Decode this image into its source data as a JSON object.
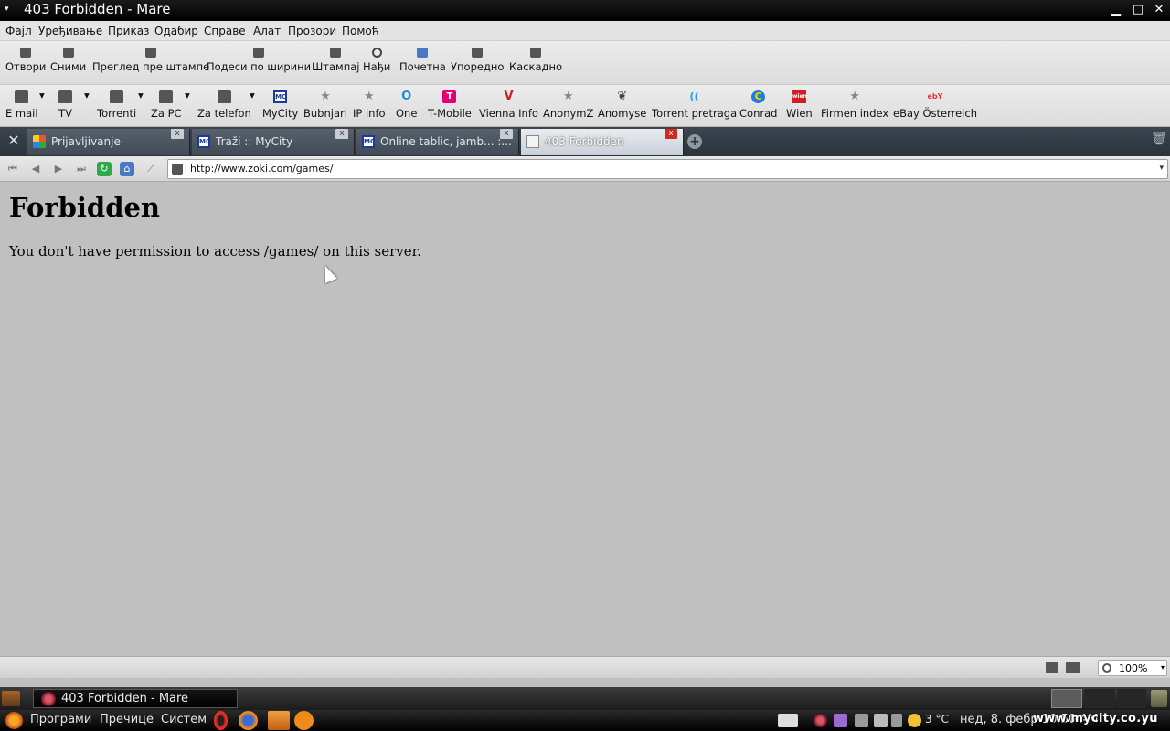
{
  "window": {
    "title": "403 Forbidden - Mare",
    "menu_arrow": "▾",
    "minimize": "▁",
    "maximize": "□",
    "close": "✕"
  },
  "menubar": [
    "Фајл",
    "Уређивање",
    "Приказ",
    "Одабир",
    "Справе",
    "Алат",
    "Прозори",
    "Помоћ"
  ],
  "toolbar": [
    "Отвори",
    "Сними",
    "Преглед пре штампе",
    "Подеси по ширини",
    "Штампај",
    "Нађи",
    "Почетна",
    "Упоредно",
    "Каскадно"
  ],
  "bookmarks": [
    {
      "label": "E mail",
      "icon": "folder-icon",
      "dropdown": true
    },
    {
      "label": "TV",
      "icon": "folder-icon",
      "dropdown": true
    },
    {
      "label": "Torrenti",
      "icon": "folder-icon",
      "dropdown": true
    },
    {
      "label": "Za PC",
      "icon": "folder-icon",
      "dropdown": true
    },
    {
      "label": "Za telefon",
      "icon": "folder-icon",
      "dropdown": true
    },
    {
      "label": "MyCity",
      "icon": "mycity-icon"
    },
    {
      "label": "Bubnjari",
      "icon": "star-icon"
    },
    {
      "label": "IP info",
      "icon": "star-icon"
    },
    {
      "label": "One",
      "icon": "one-logo-icon"
    },
    {
      "label": "T-Mobile",
      "icon": "tmobile-logo-icon"
    },
    {
      "label": "Vienna Info",
      "icon": "vienna-logo-icon"
    },
    {
      "label": "AnonymZ",
      "icon": "star-icon"
    },
    {
      "label": "Anomyse",
      "icon": "anomyse-logo-icon"
    },
    {
      "label": "Torrent pretraga",
      "icon": "signal-icon"
    },
    {
      "label": "Conrad",
      "icon": "conrad-logo-icon"
    },
    {
      "label": "Wien",
      "icon": "wien-logo-icon"
    },
    {
      "label": "Firmen index",
      "icon": "star-icon"
    },
    {
      "label": "eBay Österreich",
      "icon": "ebay-logo-icon"
    }
  ],
  "bookmark_glyphs": {
    "star": "★",
    "mycity": "MC",
    "one": "O",
    "tmobile": "T",
    "vienna": "V",
    "anomyse": "❦",
    "signal": "((",
    "conrad": "C",
    "wien": "wien",
    "ebay": "ebY",
    "dropdown": "▾"
  },
  "tabs": [
    {
      "title": "Prijavljivanje",
      "active": false,
      "favicon": "color"
    },
    {
      "title": "Traži :: MyCity",
      "active": false,
      "favicon": "mycity"
    },
    {
      "title": "Online tablic, jamb... :...",
      "active": false,
      "favicon": "mycity"
    },
    {
      "title": "403 Forbidden",
      "active": true,
      "favicon": "doc"
    }
  ],
  "tab_glyphs": {
    "tools": "✕",
    "close": "x",
    "new_tab": "+",
    "trash": "🗑",
    "mycity": "MC"
  },
  "nav": {
    "rewind": "⏮",
    "back": "◀",
    "forward": "▶",
    "fastforward": "⏭",
    "reload": "↻",
    "home": "⌂",
    "wand": "⟋",
    "url": "http://www.zoki.com/games/",
    "url_dropdown": "▾"
  },
  "page": {
    "heading": "Forbidden",
    "message": "You don't have permission to access /games/ on this server."
  },
  "statusbar": {
    "zoom": "100%",
    "zoom_dropdown": "▾"
  },
  "taskbar": {
    "window_item": "403 Forbidden - Mare",
    "menus": [
      "Програми",
      "Пречице",
      "Систем"
    ],
    "weather": "3 °C",
    "clock": "нед, 8. фебр 10:50 AM",
    "watermark": "www.mycity.co.yu"
  }
}
